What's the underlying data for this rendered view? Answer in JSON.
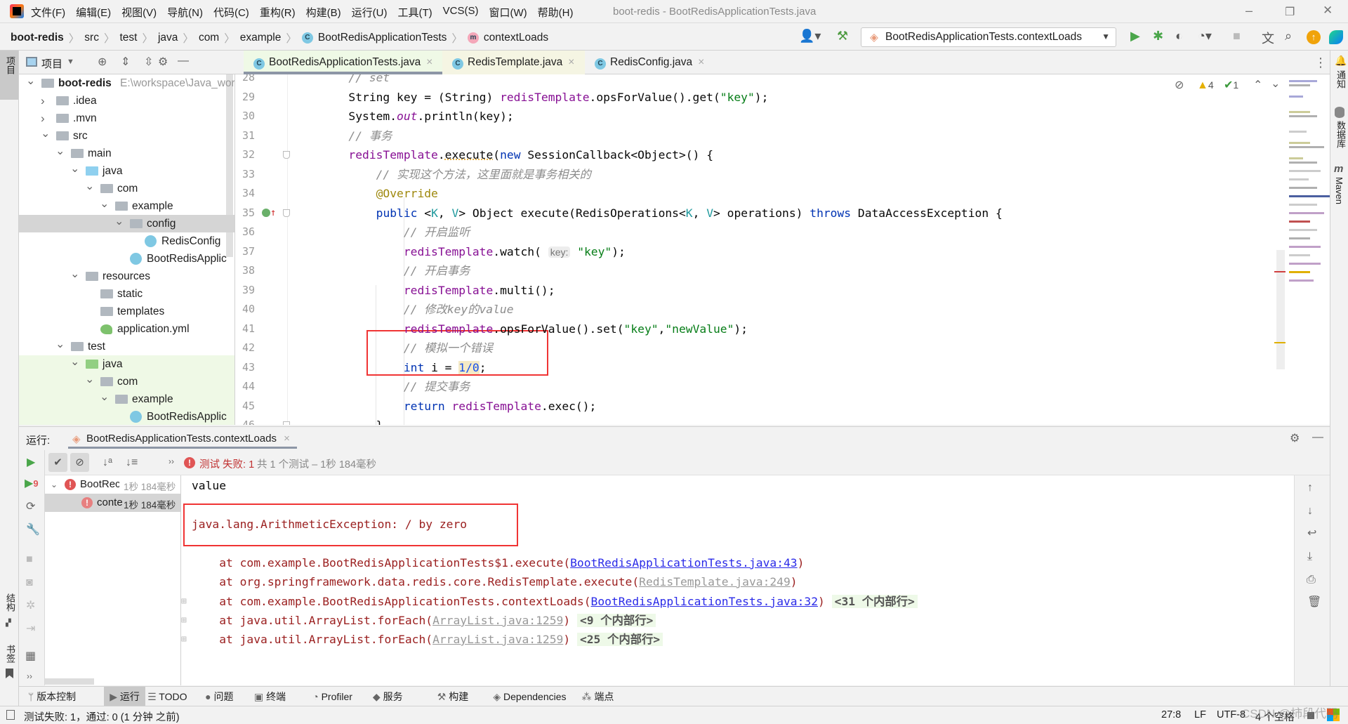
{
  "window": {
    "title": "boot-redis - BootRedisApplicationTests.java",
    "minimize": "–",
    "restore": "❐",
    "close": "✕"
  },
  "menu": [
    "文件(F)",
    "编辑(E)",
    "视图(V)",
    "导航(N)",
    "代码(C)",
    "重构(R)",
    "构建(B)",
    "运行(U)",
    "工具(T)",
    "VCS(S)",
    "窗口(W)",
    "帮助(H)"
  ],
  "breadcrumb": {
    "project": "boot-redis",
    "parts": [
      "src",
      "test",
      "java",
      "com",
      "example"
    ],
    "class": "BootRedisApplicationTests",
    "method": "contextLoads"
  },
  "run_config": {
    "selected": "BootRedisApplicationTests.contextLoads"
  },
  "left_strip": {
    "project": "项目",
    "structure": "结构",
    "bookmarks": "书签"
  },
  "right_strip": {
    "notifications": "通知",
    "database": "数据库",
    "maven": "Maven"
  },
  "project_panel": {
    "title": "项目"
  },
  "tree": [
    {
      "label": "boot-redis",
      "path": "E:\\workspace\\Java_wor",
      "level": 0,
      "chev": "open",
      "icon": "module",
      "bold": true
    },
    {
      "label": ".idea",
      "level": 1,
      "chev": "closed",
      "icon": "folder"
    },
    {
      "label": ".mvn",
      "level": 1,
      "chev": "closed",
      "icon": "folder"
    },
    {
      "label": "src",
      "level": 1,
      "chev": "open",
      "icon": "folder"
    },
    {
      "label": "main",
      "level": 2,
      "chev": "open",
      "icon": "folder"
    },
    {
      "label": "java",
      "level": 3,
      "chev": "open",
      "icon": "source-folder"
    },
    {
      "label": "com",
      "level": 4,
      "chev": "open",
      "icon": "package"
    },
    {
      "label": "example",
      "level": 5,
      "chev": "open",
      "icon": "package"
    },
    {
      "label": "config",
      "level": 6,
      "chev": "open",
      "icon": "package",
      "selected": true
    },
    {
      "label": "RedisConfig",
      "level": 7,
      "icon": "class"
    },
    {
      "label": "BootRedisApplic",
      "level": 6,
      "icon": "spring-class"
    },
    {
      "label": "resources",
      "level": 3,
      "chev": "open",
      "icon": "resources-folder"
    },
    {
      "label": "static",
      "level": 4,
      "icon": "folder"
    },
    {
      "label": "templates",
      "level": 4,
      "icon": "folder"
    },
    {
      "label": "application.yml",
      "level": 4,
      "icon": "yml"
    },
    {
      "label": "test",
      "level": 2,
      "chev": "open",
      "icon": "folder"
    },
    {
      "label": "java",
      "level": 3,
      "chev": "open",
      "icon": "test-folder",
      "test": true
    },
    {
      "label": "com",
      "level": 4,
      "chev": "open",
      "icon": "package",
      "test": true
    },
    {
      "label": "example",
      "level": 5,
      "chev": "open",
      "icon": "package",
      "test": true
    },
    {
      "label": "BootRedisApplic",
      "level": 6,
      "icon": "test-class",
      "test": true
    }
  ],
  "tabs": [
    {
      "label": "BootRedisApplicationTests.java",
      "active": true
    },
    {
      "label": "RedisTemplate.java",
      "library": true
    },
    {
      "label": "RedisConfig.java"
    }
  ],
  "inspections": {
    "warnings": "4",
    "weak_warnings": "1"
  },
  "code": [
    {
      "n": "28",
      "t": [
        [
          "        // set",
          "cm"
        ]
      ]
    },
    {
      "n": "29",
      "t": [
        [
          "        String key = (String) ",
          "pl"
        ],
        [
          "redisTemplate",
          "fd"
        ],
        [
          ".opsForValue().get(",
          "pl"
        ],
        [
          "\"key\"",
          "st"
        ],
        [
          ");",
          "pl"
        ]
      ]
    },
    {
      "n": "30",
      "t": [
        [
          "        System.",
          "pl"
        ],
        [
          "out",
          "it"
        ],
        [
          ".println(key);",
          "pl"
        ]
      ]
    },
    {
      "n": "31",
      "t": [
        [
          "        // 事务",
          "cm"
        ]
      ]
    },
    {
      "n": "32",
      "t": [
        [
          "        ",
          "pl"
        ],
        [
          "redisTemplate",
          "fd"
        ],
        [
          ".",
          "pl"
        ],
        [
          "execute",
          "wu"
        ],
        [
          "(",
          "pl"
        ],
        [
          "new",
          "kw"
        ],
        [
          " SessionCallback<Object>() {",
          "pl"
        ]
      ]
    },
    {
      "n": "33",
      "t": [
        [
          "            // 实现这个方法，这里面就是事务相关的",
          "cm"
        ]
      ]
    },
    {
      "n": "34",
      "t": [
        [
          "            @Override",
          "an"
        ]
      ]
    },
    {
      "n": "35",
      "t": [
        [
          "            ",
          "pl"
        ],
        [
          "public",
          "kw"
        ],
        [
          " <",
          "pl"
        ],
        [
          "K",
          "tp"
        ],
        [
          ", ",
          "pl"
        ],
        [
          "V",
          "tp"
        ],
        [
          "> Object execute(RedisOperations<",
          "pl"
        ],
        [
          "K",
          "tp"
        ],
        [
          ", ",
          "pl"
        ],
        [
          "V",
          "tp"
        ],
        [
          "> operations) ",
          "pl"
        ],
        [
          "throws",
          "kw"
        ],
        [
          " DataAccessException {",
          "pl"
        ]
      ]
    },
    {
      "n": "36",
      "t": [
        [
          "                // 开启监听",
          "cm"
        ]
      ]
    },
    {
      "n": "37",
      "t": [
        [
          "                ",
          "pl"
        ],
        [
          "redisTemplate",
          "fd"
        ],
        [
          ".watch( ",
          "pl"
        ],
        [
          "key:",
          "hint"
        ],
        [
          " ",
          "pl"
        ],
        [
          "\"key\"",
          "st"
        ],
        [
          ");",
          "pl"
        ]
      ]
    },
    {
      "n": "38",
      "t": [
        [
          "                // 开启事务",
          "cm"
        ]
      ]
    },
    {
      "n": "39",
      "t": [
        [
          "                ",
          "pl"
        ],
        [
          "redisTemplate",
          "fd"
        ],
        [
          ".multi();",
          "pl"
        ]
      ]
    },
    {
      "n": "40",
      "t": [
        [
          "                // 修改key的value",
          "cm"
        ]
      ]
    },
    {
      "n": "41",
      "t": [
        [
          "                ",
          "pl"
        ],
        [
          "redisTemplate",
          "fd"
        ],
        [
          ".opsForValue().set(",
          "pl"
        ],
        [
          "\"key\"",
          "st"
        ],
        [
          ",",
          "pl"
        ],
        [
          "\"newValue\"",
          "st"
        ],
        [
          ");",
          "pl"
        ]
      ]
    },
    {
      "n": "42",
      "t": [
        [
          "                // 模拟一个错误",
          "cm"
        ]
      ]
    },
    {
      "n": "43",
      "t": [
        [
          "                ",
          "pl"
        ],
        [
          "int",
          "kw"
        ],
        [
          " i = ",
          "pl"
        ],
        [
          "1/0",
          "nu"
        ],
        [
          ";",
          "pl"
        ]
      ]
    },
    {
      "n": "44",
      "t": [
        [
          "                // 提交事务",
          "cm"
        ]
      ]
    },
    {
      "n": "45",
      "t": [
        [
          "                ",
          "pl"
        ],
        [
          "return",
          "kw"
        ],
        [
          " ",
          "pl"
        ],
        [
          "redisTemplate",
          "fd"
        ],
        [
          ".exec();",
          "pl"
        ]
      ]
    },
    {
      "n": "46",
      "t": [
        [
          "            }",
          "pl"
        ]
      ]
    }
  ],
  "run": {
    "label": "运行:",
    "tab": "BootRedisApplicationTests.contextLoads",
    "status_fail": "测试 失败: 1",
    "status_rest": "共 1 个测试 – 1秒 184毫秒",
    "rerun_failed_count": "9",
    "tree": [
      {
        "label": "BootRec",
        "time": "1秒 184毫秒"
      },
      {
        "label": "conte",
        "time": "1秒 184毫秒"
      }
    ],
    "console": [
      [
        [
          "value",
          "pl"
        ]
      ],
      [
        [
          "java.lang.ArithmeticException: / by zero",
          "ex"
        ]
      ],
      [
        [
          "    at com.example.BootRedisApplicationTests$1.execute(",
          "ex"
        ],
        [
          "BootRedisApplicationTests.java:43",
          "lk"
        ],
        [
          ")",
          "ex"
        ]
      ],
      [
        [
          "    at org.springframework.data.redis.core.RedisTemplate.execute(",
          "ex"
        ],
        [
          "RedisTemplate.java:249",
          "lg"
        ],
        [
          ")",
          "ex"
        ]
      ],
      [
        [
          "    at com.example.BootRedisApplicationTests.contextLoads(",
          "ex"
        ],
        [
          "BootRedisApplicationTests.java:32",
          "lk"
        ],
        [
          ")",
          "ex"
        ],
        [
          " ",
          "pl"
        ],
        [
          "<31 个内部行>",
          "fold"
        ]
      ],
      [
        [
          "    at java.util.ArrayList.forEach(",
          "ex"
        ],
        [
          "ArrayList.java:1259",
          "lg"
        ],
        [
          ")",
          "ex"
        ],
        [
          " ",
          "pl"
        ],
        [
          "<9 个内部行>",
          "fold"
        ]
      ],
      [
        [
          "    at java.util.ArrayList.forEach(",
          "ex"
        ],
        [
          "ArrayList.java:1259",
          "lg"
        ],
        [
          ")",
          "ex"
        ],
        [
          " ",
          "pl"
        ],
        [
          "<25 个内部行>",
          "fold"
        ]
      ]
    ]
  },
  "tool_windows": [
    "版本控制",
    "运行",
    "TODO",
    "问题",
    "终端",
    "Profiler",
    "服务",
    "构建",
    "Dependencies",
    "端点"
  ],
  "status": {
    "message": "测试失败: 1，通过: 0 (1 分钟 之前)",
    "position": "27:8",
    "line_sep": "LF",
    "encoding": "UTF-8",
    "indent": "4 个空格",
    "watermark": "CSDN @柿段代码"
  },
  "colors": {
    "keyword": "#0033b3",
    "field": "#871094",
    "string": "#067d17",
    "comment": "#8c8c8c",
    "error": "#9b2020",
    "link": "#2a2ae8",
    "highlight_box": "#f03434"
  }
}
